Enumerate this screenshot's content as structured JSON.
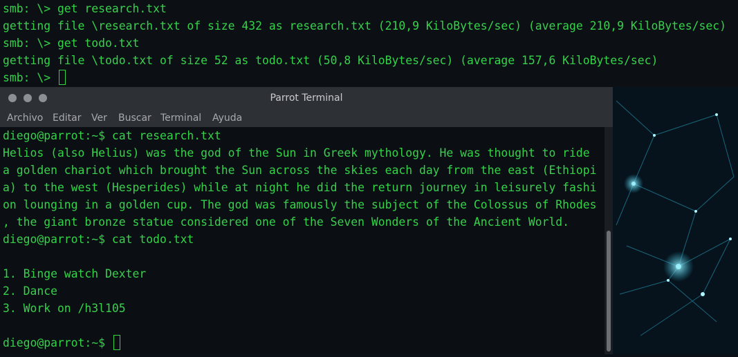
{
  "background_terminal": {
    "lines": [
      "smb: \\> get research.txt",
      "getting file \\research.txt of size 432 as research.txt (210,9 KiloBytes/sec) (average 210,9 KiloBytes/sec)",
      "smb: \\> get todo.txt",
      "getting file \\todo.txt of size 52 as todo.txt (50,8 KiloBytes/sec) (average 157,6 KiloBytes/sec)",
      "smb: \\> "
    ]
  },
  "window": {
    "title": "Parrot Terminal",
    "menu": [
      "Archivo",
      "Editar",
      "Ver",
      "Buscar",
      "Terminal",
      "Ayuda"
    ]
  },
  "terminal": {
    "lines": [
      "diego@parrot:~$ cat research.txt",
      "Helios (also Helius) was the god of the Sun in Greek mythology. He was thought to ride",
      "a golden chariot which brought the Sun across the skies each day from the east (Ethiopi",
      "a) to the west (Hesperides) while at night he did the return journey in leisurely fashi",
      "on lounging in a golden cup. The god was famously the subject of the Colossus of Rhodes",
      ", the giant bronze statue considered one of the Seven Wonders of the Ancient World.",
      "diego@parrot:~$ cat todo.txt",
      "",
      "1. Binge watch Dexter",
      "2. Dance",
      "3. Work on /h3l105",
      "",
      "diego@parrot:~$ "
    ]
  },
  "colors": {
    "terminal_text": "#35d24a",
    "titlebar": "#2d3035"
  }
}
